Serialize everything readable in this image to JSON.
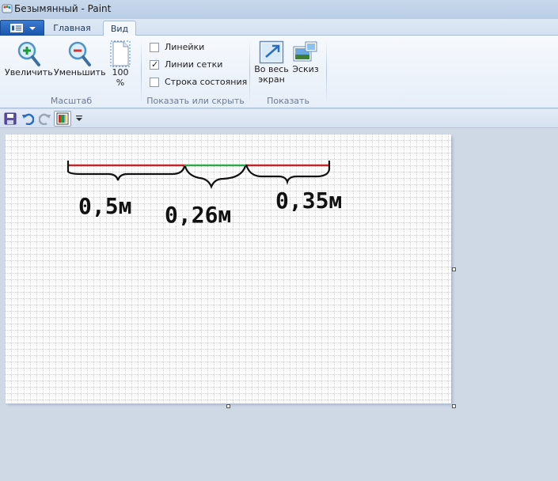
{
  "window": {
    "title": "Безымянный - Paint"
  },
  "tabs": {
    "home": "Главная",
    "view": "Вид"
  },
  "ribbon": {
    "zoom_in": "Увеличить",
    "zoom_out": "Уменьшить",
    "zoom_100": "100\n%",
    "group_scale": "Масштаб",
    "rulers": "Линейки",
    "gridlines": "Линии сетки",
    "statusbar": "Строка состояния",
    "group_showhide": "Показать или скрыть",
    "fullscreen": "Во весь экран",
    "thumbnail": "Эскиз",
    "group_display": "Показать"
  },
  "view_options": {
    "rulers_checked": false,
    "gridlines_checked": true,
    "statusbar_checked": false
  },
  "canvas": {
    "texts": {
      "left_segment": "0,5м",
      "middle_segment": "0,26м",
      "right_segment": "0,35м"
    }
  },
  "colors": {
    "accent_blue": "#1c57b0",
    "line_red": "#c0262b",
    "line_green": "#2ea84a",
    "ink": "#111111"
  },
  "icons": [
    "paint-app-icon",
    "file-menu-icon",
    "zoom-in-icon",
    "zoom-out-icon",
    "actual-size-icon",
    "fullscreen-icon",
    "thumbnail-icon",
    "save-icon",
    "undo-icon",
    "redo-icon",
    "color-palette-icon",
    "customize-dropdown-icon"
  ]
}
